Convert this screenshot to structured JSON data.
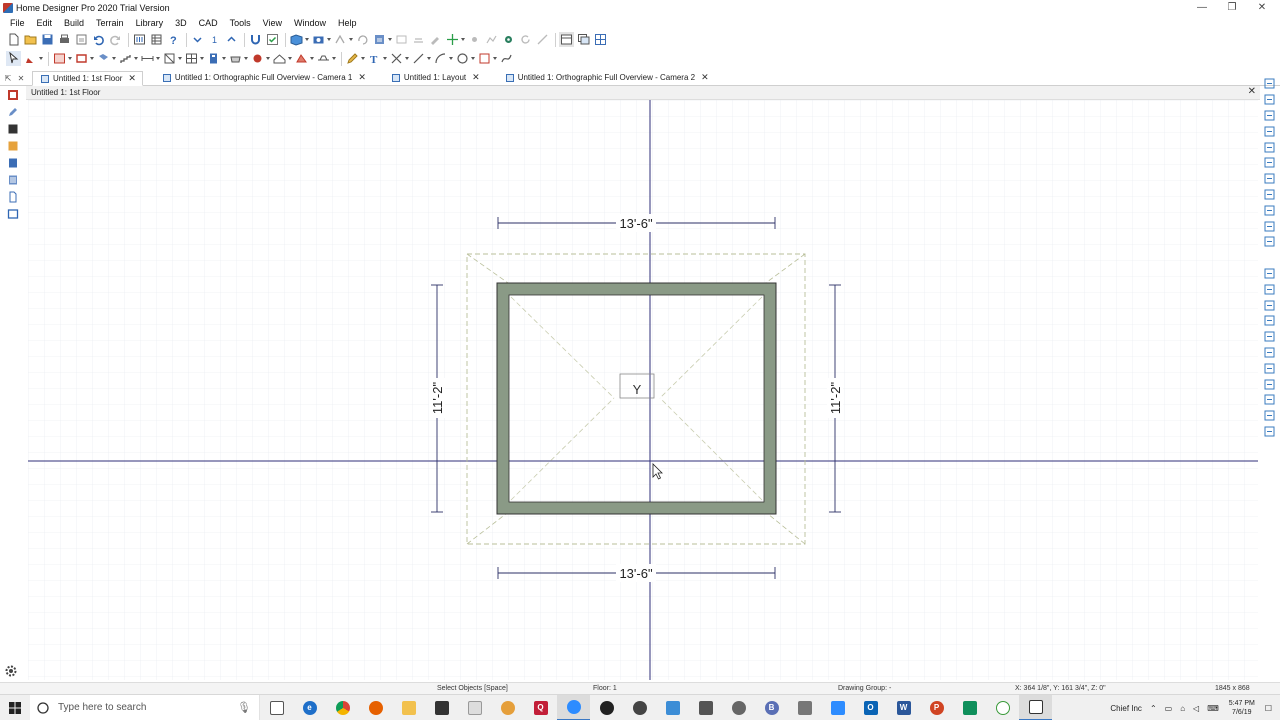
{
  "window": {
    "title": "Home Designer Pro 2020 Trial Version",
    "controls": [
      "—",
      "❐",
      "✕"
    ]
  },
  "menu": [
    "File",
    "Edit",
    "Build",
    "Terrain",
    "Library",
    "3D",
    "CAD",
    "Tools",
    "View",
    "Window",
    "Help"
  ],
  "toolbar1": {
    "floor_number": "1"
  },
  "tabs": [
    {
      "label": "Untitled 1: 1st Floor",
      "active": true
    },
    {
      "label": "Untitled 1: Orthographic Full Overview - Camera 1",
      "active": false
    },
    {
      "label": "Untitled 1: Layout",
      "active": false
    },
    {
      "label": "Untitled 1: Orthographic Full Overview - Camera 2",
      "active": false
    }
  ],
  "view": {
    "title": "Untitled 1: 1st Floor",
    "close": "✕"
  },
  "plan": {
    "top_dimension": "13'-6\"",
    "bottom_dimension": "13'-6\"",
    "left_dimension": "11'-2\"",
    "right_dimension": "11'-2\"",
    "wall_color": "#8a9a86",
    "dimension_color": "#2b2f66",
    "roof_line_color": "#b9bf9a",
    "axis_color": "#2f2f7a"
  },
  "status": {
    "hint": "Select Objects [Space]",
    "floor": "Floor: 1",
    "drawing_group": "Drawing Group: -",
    "coords": "X: 364 1/8\", Y: 161 3/4\", Z: 0\"",
    "resolution": "1845 x 868"
  },
  "taskbar": {
    "search_placeholder": "Type here to search",
    "tray_user": "Chief Inc",
    "time": "5:47 PM",
    "date": "7/6/19"
  }
}
